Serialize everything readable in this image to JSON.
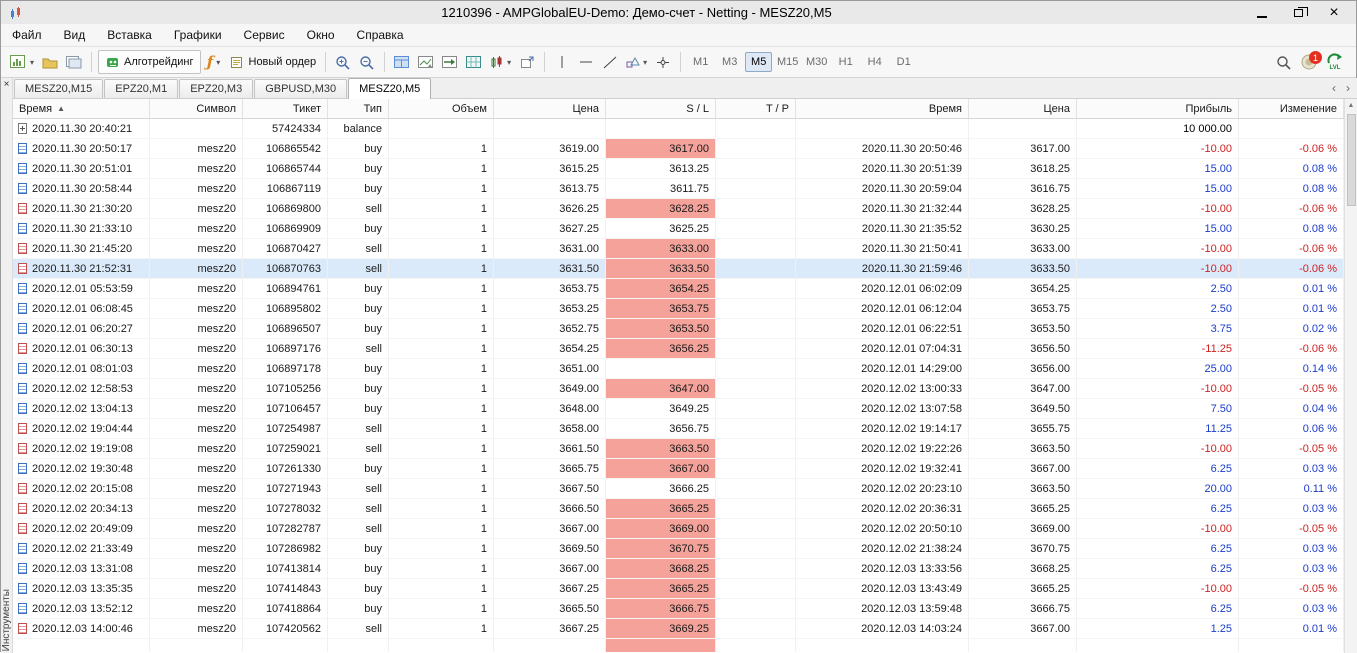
{
  "window": {
    "title": "1210396 - AMPGlobalEU-Demo: Демо-счет - Netting - MESZ20,M5"
  },
  "icons": {
    "close": "×",
    "caret": "▾",
    "sort_asc": "▲",
    "scroll_up": "▲",
    "tab_prev": "‹",
    "tab_next": "›",
    "fx": "ƒ"
  },
  "menu": {
    "items": [
      "Файл",
      "Вид",
      "Вставка",
      "Графики",
      "Сервис",
      "Окно",
      "Справка"
    ]
  },
  "toolbar": {
    "algotrading": "Алготрейдинг",
    "new_order": "Новый ордер",
    "timeframes": [
      "M1",
      "M3",
      "M5",
      "M15",
      "M30",
      "H1",
      "H4",
      "D1"
    ],
    "active_timeframe": "M5",
    "notification_badge": "1",
    "lvl": "LVL"
  },
  "tabs": {
    "items": [
      "MESZ20,M15",
      "EPZ20,M1",
      "EPZ20,M3",
      "GBPUSD,M30",
      "MESZ20,M5"
    ],
    "active_index": 4
  },
  "side_panel": {
    "caption": "Инструменты"
  },
  "colors": {
    "negative": "#cc2222",
    "positive": "#1b3cc8",
    "sl_hit": "#f4a29a",
    "selected_row": "#dbeafb",
    "balance_text": "#000000"
  },
  "table": {
    "columns": [
      "Время",
      "Символ",
      "Тикет",
      "Тип",
      "Объем",
      "Цена",
      "S / L",
      "T / P",
      "Время",
      "Цена",
      "Прибыль",
      "Изменение"
    ],
    "rows": [
      {
        "t1": "2020.11.30 20:40:21",
        "sym": "",
        "ticket": "57424334",
        "type": "balance",
        "vol": "",
        "price": "",
        "sl": "",
        "slr": false,
        "tp": "",
        "t2": "",
        "price2": "",
        "profit": "10 000.00",
        "chg": ""
      },
      {
        "t1": "2020.11.30 20:50:17",
        "sym": "mesz20",
        "ticket": "106865542",
        "type": "buy",
        "vol": "1",
        "price": "3619.00",
        "sl": "3617.00",
        "slr": true,
        "tp": "",
        "t2": "2020.11.30 20:50:46",
        "price2": "3617.00",
        "profit": "-10.00",
        "chg": "-0.06 %"
      },
      {
        "t1": "2020.11.30 20:51:01",
        "sym": "mesz20",
        "ticket": "106865744",
        "type": "buy",
        "vol": "1",
        "price": "3615.25",
        "sl": "3613.25",
        "slr": false,
        "tp": "",
        "t2": "2020.11.30 20:51:39",
        "price2": "3618.25",
        "profit": "15.00",
        "chg": "0.08 %"
      },
      {
        "t1": "2020.11.30 20:58:44",
        "sym": "mesz20",
        "ticket": "106867119",
        "type": "buy",
        "vol": "1",
        "price": "3613.75",
        "sl": "3611.75",
        "slr": false,
        "tp": "",
        "t2": "2020.11.30 20:59:04",
        "price2": "3616.75",
        "profit": "15.00",
        "chg": "0.08 %"
      },
      {
        "t1": "2020.11.30 21:30:20",
        "sym": "mesz20",
        "ticket": "106869800",
        "type": "sell",
        "vol": "1",
        "price": "3626.25",
        "sl": "3628.25",
        "slr": true,
        "tp": "",
        "t2": "2020.11.30 21:32:44",
        "price2": "3628.25",
        "profit": "-10.00",
        "chg": "-0.06 %"
      },
      {
        "t1": "2020.11.30 21:33:10",
        "sym": "mesz20",
        "ticket": "106869909",
        "type": "buy",
        "vol": "1",
        "price": "3627.25",
        "sl": "3625.25",
        "slr": false,
        "tp": "",
        "t2": "2020.11.30 21:35:52",
        "price2": "3630.25",
        "profit": "15.00",
        "chg": "0.08 %"
      },
      {
        "t1": "2020.11.30 21:45:20",
        "sym": "mesz20",
        "ticket": "106870427",
        "type": "sell",
        "vol": "1",
        "price": "3631.00",
        "sl": "3633.00",
        "slr": true,
        "tp": "",
        "t2": "2020.11.30 21:50:41",
        "price2": "3633.00",
        "profit": "-10.00",
        "chg": "-0.06 %"
      },
      {
        "t1": "2020.11.30 21:52:31",
        "sym": "mesz20",
        "ticket": "106870763",
        "type": "sell",
        "vol": "1",
        "price": "3631.50",
        "sl": "3633.50",
        "slr": true,
        "tp": "",
        "t2": "2020.11.30 21:59:46",
        "price2": "3633.50",
        "profit": "-10.00",
        "chg": "-0.06 %",
        "selected": true
      },
      {
        "t1": "2020.12.01 05:53:59",
        "sym": "mesz20",
        "ticket": "106894761",
        "type": "buy",
        "vol": "1",
        "price": "3653.75",
        "sl": "3654.25",
        "slr": true,
        "tp": "",
        "t2": "2020.12.01 06:02:09",
        "price2": "3654.25",
        "profit": "2.50",
        "chg": "0.01 %"
      },
      {
        "t1": "2020.12.01 06:08:45",
        "sym": "mesz20",
        "ticket": "106895802",
        "type": "buy",
        "vol": "1",
        "price": "3653.25",
        "sl": "3653.75",
        "slr": true,
        "tp": "",
        "t2": "2020.12.01 06:12:04",
        "price2": "3653.75",
        "profit": "2.50",
        "chg": "0.01 %"
      },
      {
        "t1": "2020.12.01 06:20:27",
        "sym": "mesz20",
        "ticket": "106896507",
        "type": "buy",
        "vol": "1",
        "price": "3652.75",
        "sl": "3653.50",
        "slr": true,
        "tp": "",
        "t2": "2020.12.01 06:22:51",
        "price2": "3653.50",
        "profit": "3.75",
        "chg": "0.02 %"
      },
      {
        "t1": "2020.12.01 06:30:13",
        "sym": "mesz20",
        "ticket": "106897176",
        "type": "sell",
        "vol": "1",
        "price": "3654.25",
        "sl": "3656.25",
        "slr": true,
        "tp": "",
        "t2": "2020.12.01 07:04:31",
        "price2": "3656.50",
        "profit": "-11.25",
        "chg": "-0.06 %"
      },
      {
        "t1": "2020.12.01 08:01:03",
        "sym": "mesz20",
        "ticket": "106897178",
        "type": "buy",
        "vol": "1",
        "price": "3651.00",
        "sl": "",
        "slr": false,
        "tp": "",
        "t2": "2020.12.01 14:29:00",
        "price2": "3656.00",
        "profit": "25.00",
        "chg": "0.14 %"
      },
      {
        "t1": "2020.12.02 12:58:53",
        "sym": "mesz20",
        "ticket": "107105256",
        "type": "buy",
        "vol": "1",
        "price": "3649.00",
        "sl": "3647.00",
        "slr": true,
        "tp": "",
        "t2": "2020.12.02 13:00:33",
        "price2": "3647.00",
        "profit": "-10.00",
        "chg": "-0.05 %"
      },
      {
        "t1": "2020.12.02 13:04:13",
        "sym": "mesz20",
        "ticket": "107106457",
        "type": "buy",
        "vol": "1",
        "price": "3648.00",
        "sl": "3649.25",
        "slr": false,
        "tp": "",
        "t2": "2020.12.02 13:07:58",
        "price2": "3649.50",
        "profit": "7.50",
        "chg": "0.04 %"
      },
      {
        "t1": "2020.12.02 19:04:44",
        "sym": "mesz20",
        "ticket": "107254987",
        "type": "sell",
        "vol": "1",
        "price": "3658.00",
        "sl": "3656.75",
        "slr": false,
        "tp": "",
        "t2": "2020.12.02 19:14:17",
        "price2": "3655.75",
        "profit": "11.25",
        "chg": "0.06 %"
      },
      {
        "t1": "2020.12.02 19:19:08",
        "sym": "mesz20",
        "ticket": "107259021",
        "type": "sell",
        "vol": "1",
        "price": "3661.50",
        "sl": "3663.50",
        "slr": true,
        "tp": "",
        "t2": "2020.12.02 19:22:26",
        "price2": "3663.50",
        "profit": "-10.00",
        "chg": "-0.05 %"
      },
      {
        "t1": "2020.12.02 19:30:48",
        "sym": "mesz20",
        "ticket": "107261330",
        "type": "buy",
        "vol": "1",
        "price": "3665.75",
        "sl": "3667.00",
        "slr": true,
        "tp": "",
        "t2": "2020.12.02 19:32:41",
        "price2": "3667.00",
        "profit": "6.25",
        "chg": "0.03 %"
      },
      {
        "t1": "2020.12.02 20:15:08",
        "sym": "mesz20",
        "ticket": "107271943",
        "type": "sell",
        "vol": "1",
        "price": "3667.50",
        "sl": "3666.25",
        "slr": false,
        "tp": "",
        "t2": "2020.12.02 20:23:10",
        "price2": "3663.50",
        "profit": "20.00",
        "chg": "0.11 %"
      },
      {
        "t1": "2020.12.02 20:34:13",
        "sym": "mesz20",
        "ticket": "107278032",
        "type": "sell",
        "vol": "1",
        "price": "3666.50",
        "sl": "3665.25",
        "slr": true,
        "tp": "",
        "t2": "2020.12.02 20:36:31",
        "price2": "3665.25",
        "profit": "6.25",
        "chg": "0.03 %"
      },
      {
        "t1": "2020.12.02 20:49:09",
        "sym": "mesz20",
        "ticket": "107282787",
        "type": "sell",
        "vol": "1",
        "price": "3667.00",
        "sl": "3669.00",
        "slr": true,
        "tp": "",
        "t2": "2020.12.02 20:50:10",
        "price2": "3669.00",
        "profit": "-10.00",
        "chg": "-0.05 %"
      },
      {
        "t1": "2020.12.02 21:33:49",
        "sym": "mesz20",
        "ticket": "107286982",
        "type": "buy",
        "vol": "1",
        "price": "3669.50",
        "sl": "3670.75",
        "slr": true,
        "tp": "",
        "t2": "2020.12.02 21:38:24",
        "price2": "3670.75",
        "profit": "6.25",
        "chg": "0.03 %"
      },
      {
        "t1": "2020.12.03 13:31:08",
        "sym": "mesz20",
        "ticket": "107413814",
        "type": "buy",
        "vol": "1",
        "price": "3667.00",
        "sl": "3668.25",
        "slr": true,
        "tp": "",
        "t2": "2020.12.03 13:33:56",
        "price2": "3668.25",
        "profit": "6.25",
        "chg": "0.03 %"
      },
      {
        "t1": "2020.12.03 13:35:35",
        "sym": "mesz20",
        "ticket": "107414843",
        "type": "buy",
        "vol": "1",
        "price": "3667.25",
        "sl": "3665.25",
        "slr": true,
        "tp": "",
        "t2": "2020.12.03 13:43:49",
        "price2": "3665.25",
        "profit": "-10.00",
        "chg": "-0.05 %"
      },
      {
        "t1": "2020.12.03 13:52:12",
        "sym": "mesz20",
        "ticket": "107418864",
        "type": "buy",
        "vol": "1",
        "price": "3665.50",
        "sl": "3666.75",
        "slr": true,
        "tp": "",
        "t2": "2020.12.03 13:59:48",
        "price2": "3666.75",
        "profit": "6.25",
        "chg": "0.03 %"
      },
      {
        "t1": "2020.12.03 14:00:46",
        "sym": "mesz20",
        "ticket": "107420562",
        "type": "sell",
        "vol": "1",
        "price": "3667.25",
        "sl": "3669.25",
        "slr": true,
        "tp": "",
        "t2": "2020.12.03 14:03:24",
        "price2": "3667.00",
        "profit": "1.25",
        "chg": "0.01 %"
      },
      {
        "t1": "",
        "sym": "",
        "ticket": "",
        "type": "",
        "vol": "",
        "price": "",
        "sl": "",
        "slr": true,
        "tp": "",
        "t2": "",
        "price2": "",
        "profit": "",
        "chg": "",
        "partial": true
      }
    ]
  }
}
